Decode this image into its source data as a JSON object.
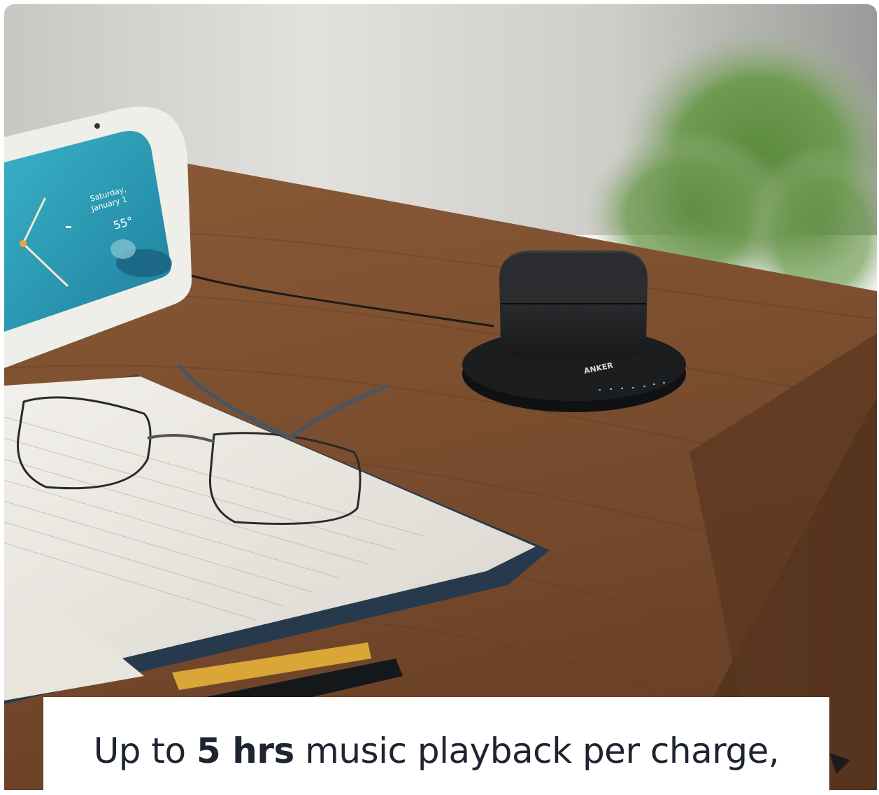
{
  "photo": {
    "device_screen": {
      "date_line1": "Saturday,",
      "date_line2": "January 1",
      "temperature": "55°"
    },
    "case_brand": "ANKER"
  },
  "caption": {
    "prefix": "Up to ",
    "bold": "5 hrs",
    "suffix": " music playback per charge,"
  },
  "colors": {
    "wall": "#d9d7d3",
    "wood": "#7a4f31",
    "screen": "#2b9fb6",
    "caption_text": "#1f2530"
  }
}
